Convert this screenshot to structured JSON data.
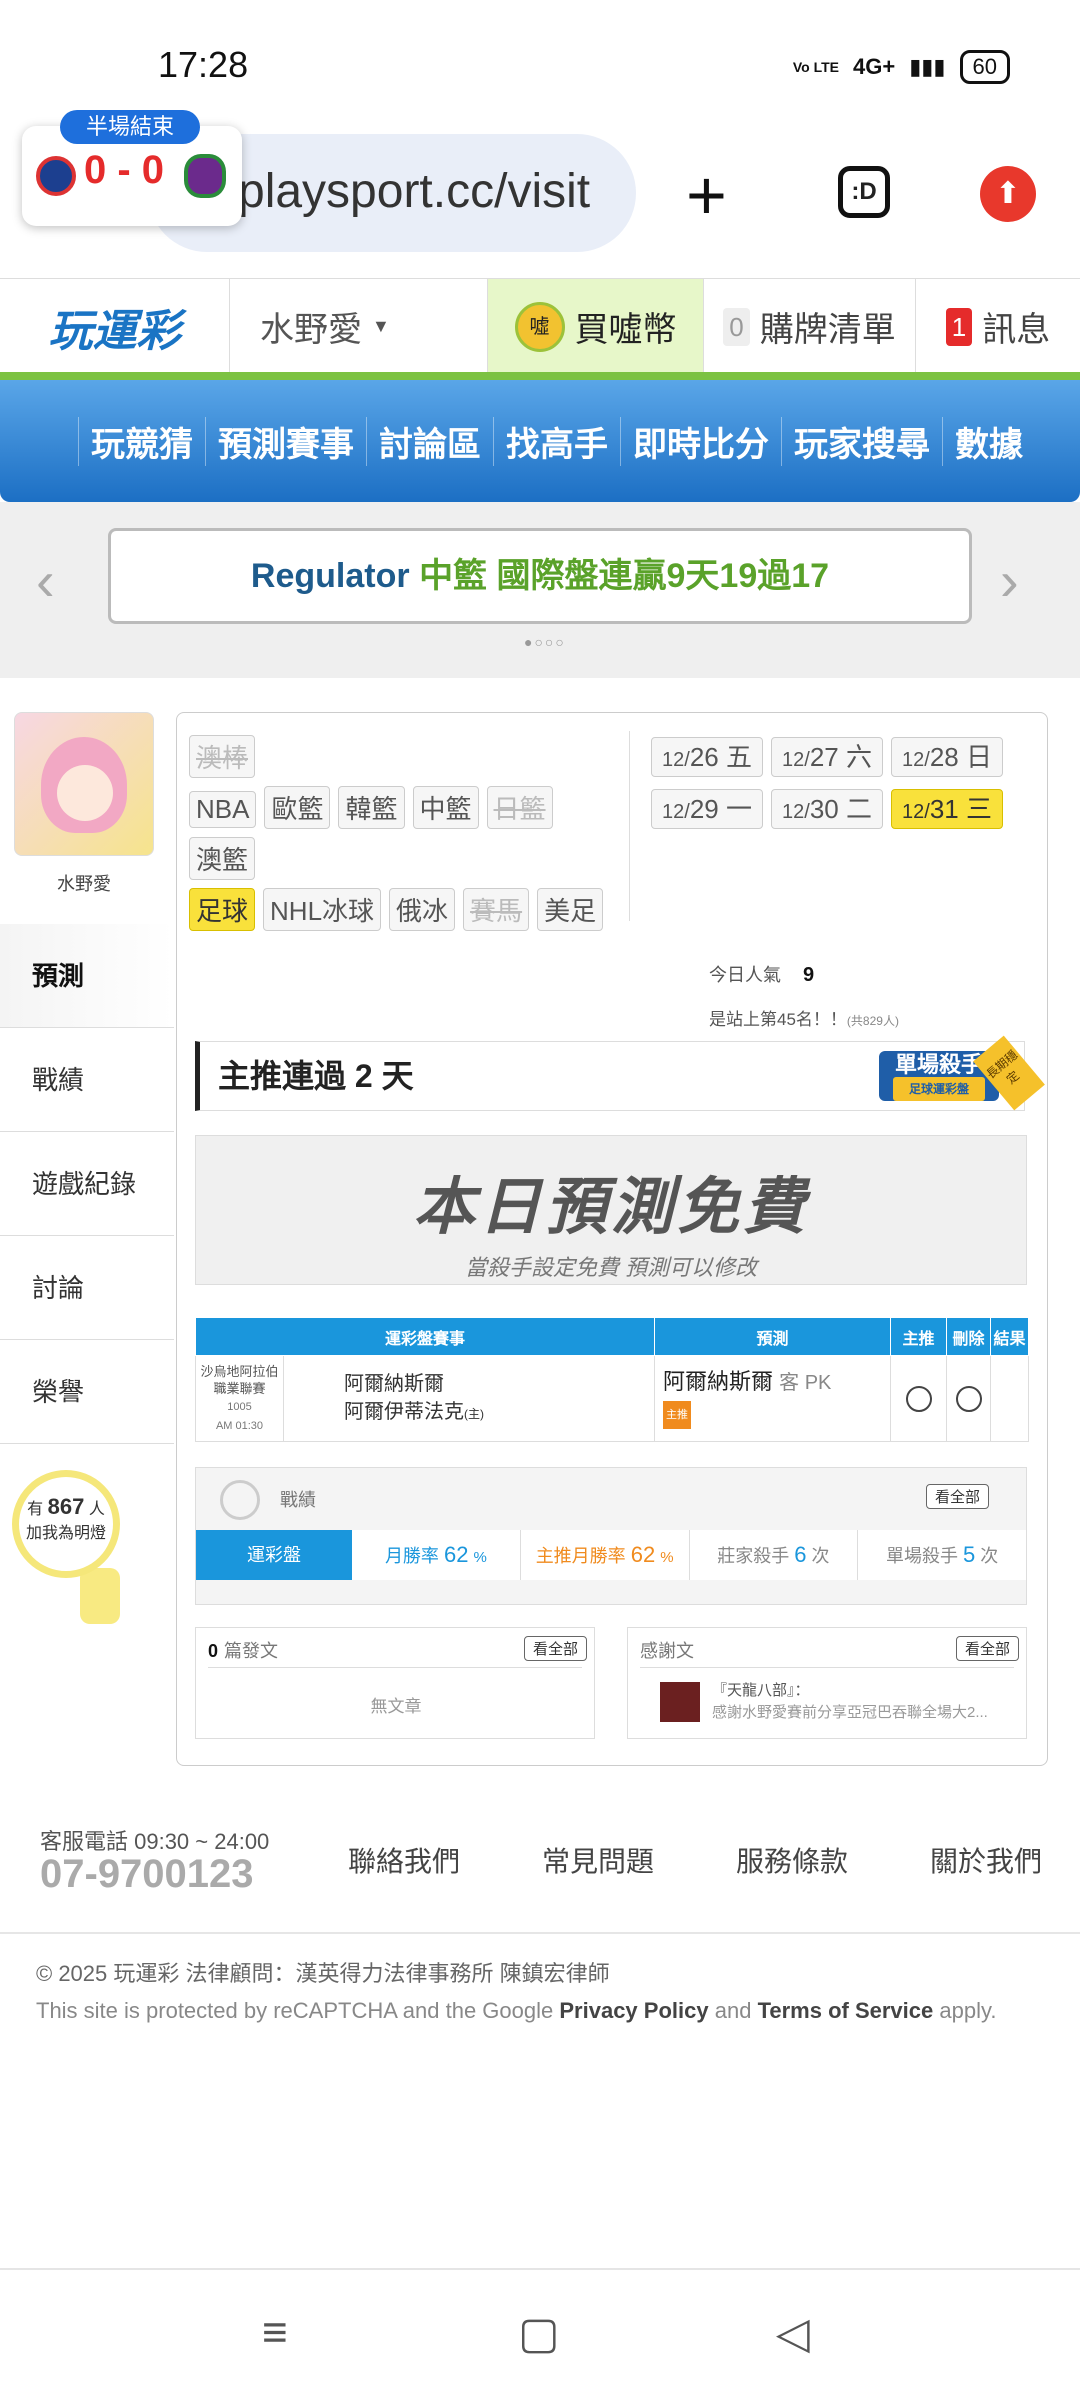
{
  "status_bar": {
    "time": "17:28",
    "signal": "4G+",
    "battery": "60",
    "volte": "Vo LTE"
  },
  "browser": {
    "url": "playsport.cc/visit",
    "score_badge": "半場結束",
    "score": "0 - 0",
    "plus_label": "+",
    "tabs_label": ":D",
    "upgrade_icon": "arrow-up-icon"
  },
  "site_header": {
    "logo": "玩運彩",
    "user": "水野愛",
    "buy_coin": "買噓幣",
    "coin_label": "噓",
    "cart_count": "0",
    "cart": "購牌清單",
    "msg_count": "1",
    "msg": "訊息"
  },
  "main_nav": [
    "玩競猜",
    "預測賽事",
    "討論區",
    "找高手",
    "即時比分",
    "玩家搜尋",
    "數據"
  ],
  "banner": {
    "part1": "Regulator",
    "part2": "中籃 國際盤連贏9天19過17"
  },
  "profile": {
    "name": "水野愛"
  },
  "side_menu": [
    "預測",
    "戰績",
    "遊戲紀錄",
    "討論",
    "榮譽"
  ],
  "fans": {
    "prefix": "有",
    "count": "867",
    "unit": "人",
    "label": "加我為明燈"
  },
  "sports": {
    "row1": [
      {
        "label": "澳棒",
        "dim": true
      }
    ],
    "row2": [
      {
        "label": "NBA"
      },
      {
        "label": "歐籃"
      },
      {
        "label": "韓籃"
      },
      {
        "label": "中籃"
      },
      {
        "label": "日籃",
        "dim": true
      }
    ],
    "row3": [
      {
        "label": "澳籃"
      }
    ],
    "row4": [
      {
        "label": "足球",
        "selected": true
      },
      {
        "label": "NHL冰球"
      },
      {
        "label": "俄冰"
      },
      {
        "label": "賽馬",
        "dim": true
      },
      {
        "label": "美足"
      }
    ]
  },
  "dates": [
    {
      "m": "12/",
      "d": "26 五"
    },
    {
      "m": "12/",
      "d": "27 六"
    },
    {
      "m": "12/",
      "d": "28 日"
    },
    {
      "m": "12/",
      "d": "29 一"
    },
    {
      "m": "12/",
      "d": "30 二"
    },
    {
      "m": "12/",
      "d": "31 三",
      "selected": true
    }
  ],
  "popularity": {
    "label": "今日人氣",
    "value": "9",
    "rank": "是站上第45名！！",
    "total": "(共829人)"
  },
  "streak": {
    "title": "主推連過 2 天",
    "badge": "單場殺手",
    "badge_sub": "足球運彩盤",
    "ribbon": "長期穩定"
  },
  "free": {
    "title": "本日預測免費",
    "sub": "當殺手設定免費 預測可以修改"
  },
  "pred_table": {
    "headers": [
      "運彩盤賽事",
      "預測",
      "主推",
      "刪除",
      "結果"
    ],
    "row": {
      "league": "沙烏地阿拉伯職業聯賽",
      "game_no": "1005",
      "time": "AM 01:30",
      "team_away": "阿爾納斯爾",
      "team_home": "阿爾伊蒂法克",
      "home_mark": "(主)",
      "pick": "阿爾納斯爾",
      "pick_type": "客 PK",
      "tag": "主推"
    }
  },
  "record": {
    "title": "戰績",
    "view_all": "看全部",
    "type": "運彩盤",
    "win_rate_label": "月勝率",
    "win_rate": "62",
    "main_win_rate_label": "主推月勝率",
    "main_win_rate": "62",
    "pct": "%",
    "banker_label": "莊家殺手",
    "banker_value": "6",
    "single_label": "單場殺手",
    "single_value": "5",
    "times": "次"
  },
  "posts": {
    "count": "0",
    "label": "篇發文",
    "view_all": "看全部",
    "empty": "無文章"
  },
  "thanks": {
    "label": "感謝文",
    "view_all": "看全部",
    "title": "『天龍八部』：",
    "text": "感謝水野愛賽前分享亞冠巴吞聯全場大2..."
  },
  "footer": {
    "phone_label": "客服電話 09:30 ~ 24:00",
    "phone": "07-9700123",
    "links": [
      "聯絡我們",
      "常見問題",
      "服務條款",
      "關於我們"
    ],
    "copyright": "© 2025 玩運彩 法律顧問：漢英得力法律事務所 陳鎮宏律師",
    "recaptcha_1": "This site is protected by reCAPTCHA and the Google",
    "privacy": "Privacy Policy",
    "and": "and",
    "terms": "Terms of Service",
    "apply": "apply."
  },
  "sysnav": {
    "menu": "≡",
    "home": "▢",
    "back": "◁"
  }
}
